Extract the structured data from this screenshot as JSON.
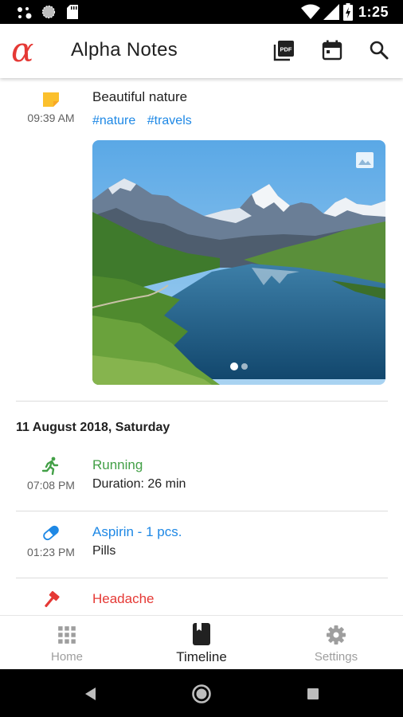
{
  "status_bar": {
    "time": "1:25"
  },
  "app_bar": {
    "logo": "α",
    "title": "Alpha Notes",
    "actions": [
      {
        "name": "pdf-export",
        "icon": "pdf-icon",
        "label": "PDF"
      },
      {
        "name": "calendar",
        "icon": "calendar-icon"
      },
      {
        "name": "search",
        "icon": "search-icon"
      }
    ]
  },
  "colors": {
    "accent_red": "#e53935",
    "note_yellow": "#fbc02d",
    "running_green": "#43a047",
    "medicine_blue": "#1e88e5",
    "headache_red": "#e53935"
  },
  "note_entry": {
    "icon": "note-icon",
    "time": "09:39 AM",
    "title": "Beautiful nature",
    "tags": [
      "#nature",
      "#travels"
    ],
    "photo": {
      "icon": "image-gallery-icon",
      "page_count": 2,
      "current_page": 1
    }
  },
  "date_header": "11 August 2018, Saturday",
  "entries": [
    {
      "icon": "running-icon",
      "time": "07:08 PM",
      "title": "Running",
      "subtitle": "Duration: 26 min",
      "color": "#43a047"
    },
    {
      "icon": "pill-icon",
      "time": "01:23 PM",
      "title": "Aspirin - 1 pcs.",
      "subtitle": "Pills",
      "color": "#1e88e5"
    },
    {
      "icon": "hammer-icon",
      "time": "",
      "title": "Headache",
      "subtitle": "",
      "color": "#e53935"
    }
  ],
  "bottom_nav": {
    "items": [
      {
        "label": "Home",
        "icon": "grid-icon",
        "active": false
      },
      {
        "label": "Timeline",
        "icon": "book-icon",
        "active": true
      },
      {
        "label": "Settings",
        "icon": "gear-icon",
        "active": false
      }
    ]
  },
  "system_nav": {
    "buttons": [
      "back",
      "home",
      "recents"
    ]
  }
}
